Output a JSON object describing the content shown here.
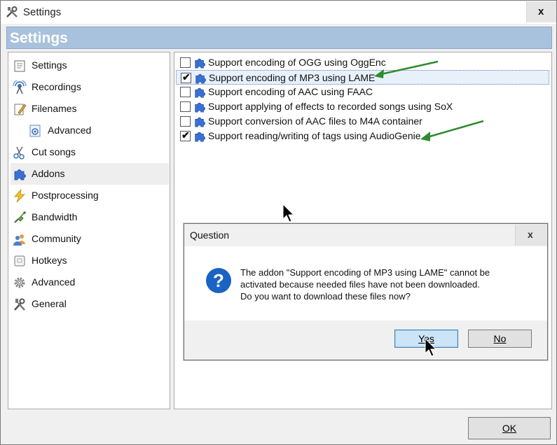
{
  "window": {
    "title": "Settings",
    "header": "Settings",
    "close_glyph": "x"
  },
  "sidebar": {
    "items": [
      {
        "label": "Settings",
        "icon": "settings-icon"
      },
      {
        "label": "Recordings",
        "icon": "recordings-icon"
      },
      {
        "label": "Filenames",
        "icon": "filenames-icon"
      },
      {
        "label": "Advanced",
        "icon": "advanced-filenames-icon"
      },
      {
        "label": "Cut songs",
        "icon": "scissors-icon"
      },
      {
        "label": "Addons",
        "icon": "puzzle-icon"
      },
      {
        "label": "Postprocessing",
        "icon": "lightning-icon"
      },
      {
        "label": "Bandwidth",
        "icon": "bandwidth-icon"
      },
      {
        "label": "Community",
        "icon": "community-icon"
      },
      {
        "label": "Hotkeys",
        "icon": "hotkeys-icon"
      },
      {
        "label": "Advanced",
        "icon": "gear-icon"
      },
      {
        "label": "General",
        "icon": "tools-icon"
      }
    ],
    "selected": "Addons"
  },
  "addons": [
    {
      "label": "Support encoding of OGG using OggEnc",
      "checked": false
    },
    {
      "label": "Support encoding of MP3 using LAME",
      "checked": true
    },
    {
      "label": "Support encoding of AAC using FAAC",
      "checked": false
    },
    {
      "label": "Support applying of effects to recorded songs using SoX",
      "checked": false
    },
    {
      "label": "Support conversion of AAC files to M4A container",
      "checked": false
    },
    {
      "label": "Support reading/writing of tags using AudioGenie",
      "checked": true
    }
  ],
  "check_glyph": "✔",
  "ok_label": "OK",
  "dialog": {
    "title": "Question",
    "close_glyph": "x",
    "message_lines": [
      "The addon \"Support encoding of MP3 using LAME\" cannot be",
      "activated because needed files have not been downloaded.",
      "Do you want to download these files now?"
    ],
    "yes_label": "Yes",
    "no_label": "No"
  },
  "colors": {
    "header_band": "#a8c2dd",
    "annotation_arrow": "#2e8b2e",
    "question_icon": "#1a62c4"
  }
}
